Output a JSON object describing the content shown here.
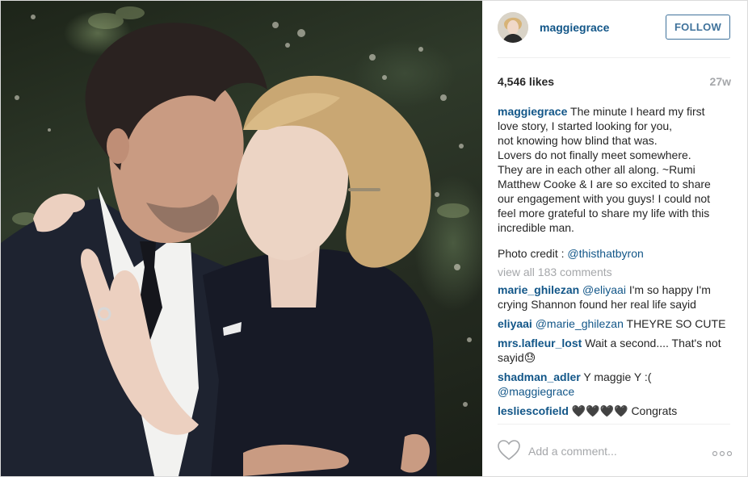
{
  "post": {
    "username": "maggiegrace",
    "follow_label": "FOLLOW",
    "likes": "4,546 likes",
    "time": "27w",
    "caption": {
      "user": "maggiegrace",
      "lines": [
        "The minute I heard my first",
        "love story, I started looking for you,",
        "not knowing how blind that was.",
        "Lovers do not finally meet somewhere.",
        "They are in each other all along. ~Rumi",
        "Matthew Cooke & I are so excited to share",
        "our engagement with you guys! I could not",
        "feel more grateful to share my life with this",
        "incredible man."
      ],
      "credit_prefix": "Photo credit : ",
      "credit_mention": "@thisthatbyron"
    },
    "view_all": "view all 183 comments",
    "comments": [
      {
        "user": "marie_ghilezan",
        "mention": "@eliyaai",
        "text": " I'm so happy I'm crying Shannon found her real life sayid"
      },
      {
        "user": "eliyaai",
        "mention": "@marie_ghilezan",
        "text": " THEYRE SO CUTE"
      },
      {
        "user": "mrs.lafleur_lost",
        "mention": "",
        "text": "Wait a second.... That's not sayid😓"
      },
      {
        "user": "shadman_adler",
        "mention": "",
        "text": "Y maggie Y :(",
        "mention_after": "@maggiegrace"
      },
      {
        "user": "lesliescofield",
        "mention": "",
        "text": "🖤🖤🖤🖤 Congrats"
      }
    ],
    "add_comment_placeholder": "Add a comment...",
    "icons": {
      "avatar": "avatar",
      "heart": "heart-icon",
      "more": "more-options-icon"
    },
    "colors": {
      "link": "#125688",
      "follow": "#3f729b",
      "muted": "#a5a7aa"
    }
  }
}
